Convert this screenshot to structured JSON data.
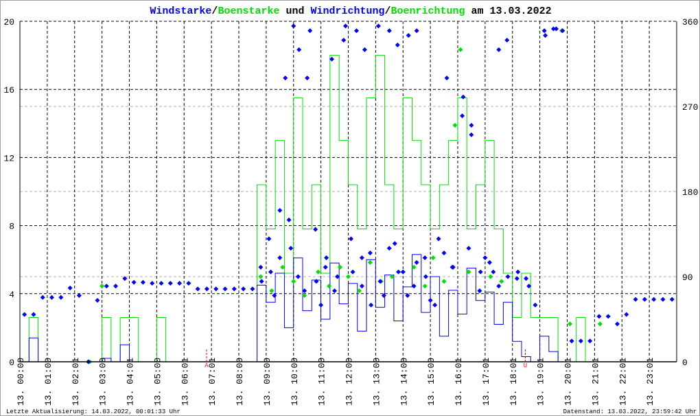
{
  "title": {
    "parts": [
      {
        "text": "Windstarke",
        "color": "#0000ff"
      },
      {
        "text": "/",
        "color": "#000000"
      },
      {
        "text": "Boenstarke",
        "color": "#00e000"
      },
      {
        "text": " und ",
        "color": "#000000"
      },
      {
        "text": "Windrichtung",
        "color": "#0000ff"
      },
      {
        "text": "/",
        "color": "#000000"
      },
      {
        "text": "Boenrichtung",
        "color": "#00e000"
      },
      {
        "text": " am 13.03.2022",
        "color": "#000000"
      }
    ]
  },
  "footer": {
    "left": "Letzte Aktualisierung: 14.03.2022, 00:01:33 Uhr",
    "right": "Datenstand: 13.03.2022, 23:59:42 Uhr"
  },
  "chart_data": {
    "type": "line",
    "title": "Windstarke/Boenstarke und Windrichtung/Boenrichtung am 13.03.2022",
    "xlabel": "",
    "ylabel": "",
    "xlim": [
      0,
      24
    ],
    "ylim": [
      0,
      20
    ],
    "y2lim": [
      0,
      360
    ],
    "yticks": [
      0,
      4,
      8,
      12,
      16,
      20
    ],
    "y2ticks": [
      0,
      90,
      180,
      270,
      360
    ],
    "xtick_labels": [
      "13. 00:00",
      "13. 01:00",
      "13. 02:01",
      "13. 03:00",
      "13. 04:01",
      "13. 05:00",
      "13. 06:01",
      "13. 07:01",
      "13. 08:00",
      "13. 09:00",
      "13. 10:00",
      "13. 11:00",
      "13. 12:00",
      "13. 13:00",
      "13. 14:00",
      "13. 15:00",
      "13. 16:01",
      "13. 17:01",
      "13. 18:01",
      "13. 19:01",
      "13. 20:01",
      "13. 21:01",
      "13. 22:01",
      "13. 23:01"
    ],
    "grid": true,
    "colors": {
      "wind": "#0000ff",
      "gust": "#00e000",
      "marker": "#ff0000",
      "grid": "#000000",
      "grid2": "#b0b0b0"
    },
    "sun_markers": [
      {
        "label": "A",
        "hour": 6.82
      },
      {
        "label": "U",
        "hour": 18.47
      }
    ],
    "step_hours": 0.3333,
    "series": [
      {
        "name": "Windstarke",
        "kind": "step",
        "axis": "left",
        "values": [
          0,
          1.4,
          0,
          0,
          0,
          0,
          0,
          0,
          0,
          0.2,
          0,
          1.0,
          0,
          0,
          0,
          0,
          0,
          0,
          0,
          0,
          0,
          0,
          0,
          0,
          0,
          0,
          4.5,
          3.5,
          5.2,
          2.0,
          6.1,
          3.0,
          4.8,
          2.5,
          5.8,
          3.4,
          4.6,
          1.8,
          6.0,
          3.2,
          5.1,
          2.4,
          4.4,
          6.3,
          2.9,
          5.0,
          1.5,
          4.2,
          2.8,
          5.5,
          3.6,
          4.1,
          2.2,
          3.5,
          1.2,
          0.3,
          0,
          1.5,
          0.6,
          0,
          0,
          0,
          0,
          0,
          0,
          0,
          0,
          0,
          0,
          0,
          0,
          0
        ]
      },
      {
        "name": "Boenstarke",
        "kind": "step",
        "axis": "left",
        "values": [
          0,
          2.6,
          0,
          0,
          0,
          0,
          0,
          0,
          0,
          2.6,
          0,
          2.6,
          2.6,
          0,
          0,
          2.6,
          0,
          0,
          0,
          0,
          0,
          0,
          0,
          0,
          0,
          0,
          10.4,
          7.8,
          13,
          5.2,
          15.5,
          7.8,
          10.4,
          5.2,
          18,
          13,
          10.4,
          7.8,
          15.5,
          18,
          10.4,
          7.8,
          15.5,
          13,
          10.4,
          7.8,
          10.4,
          13,
          15.5,
          7.8,
          10.4,
          13,
          7.8,
          5.2,
          2.6,
          5.2,
          2.6,
          2.6,
          2.6,
          0,
          0,
          2.6,
          0,
          0,
          0,
          0,
          0,
          0,
          0,
          0,
          0,
          0
        ]
      },
      {
        "name": "Windrichtung",
        "kind": "points",
        "axis": "right",
        "values": [
          50,
          50,
          68,
          68,
          68,
          78,
          70,
          0,
          65,
          80,
          80,
          88,
          84,
          84,
          83,
          83,
          83,
          83,
          83,
          77,
          77,
          77,
          77,
          77,
          77,
          77,
          85,
          95,
          110,
          150,
          90,
          300,
          85,
          100,
          75,
          340,
          95,
          110,
          60,
          85,
          120,
          95,
          70,
          105,
          90,
          60,
          115,
          100,
          260,
          240,
          95,
          105,
          80,
          90,
          88,
          88,
          60,
          350,
          352,
          350,
          22,
          22,
          22,
          48,
          48,
          40,
          50,
          66,
          66,
          66,
          66,
          66
        ],
        "extra_points": [
          [
            8.8,
            100
          ],
          [
            9.1,
            130
          ],
          [
            9.3,
            70
          ],
          [
            9.5,
            160
          ],
          [
            9.7,
            300
          ],
          [
            9.9,
            120
          ],
          [
            10.0,
            355
          ],
          [
            10.2,
            330
          ],
          [
            10.4,
            75
          ],
          [
            10.6,
            350
          ],
          [
            10.8,
            140
          ],
          [
            11.0,
            60
          ],
          [
            11.2,
            110
          ],
          [
            11.4,
            320
          ],
          [
            11.6,
            90
          ],
          [
            11.9,
            355
          ],
          [
            12.1,
            130
          ],
          [
            12.3,
            350
          ],
          [
            12.5,
            80
          ],
          [
            12.6,
            330
          ],
          [
            12.8,
            115
          ],
          [
            13.1,
            355
          ],
          [
            13.3,
            70
          ],
          [
            13.5,
            350
          ],
          [
            13.7,
            125
          ],
          [
            13.8,
            335
          ],
          [
            14.0,
            95
          ],
          [
            14.2,
            345
          ],
          [
            14.4,
            80
          ],
          [
            14.5,
            350
          ],
          [
            14.8,
            110
          ],
          [
            15.0,
            65
          ],
          [
            15.3,
            130
          ],
          [
            15.6,
            300
          ],
          [
            15.8,
            100
          ],
          [
            16.2,
            280
          ],
          [
            16.4,
            120
          ],
          [
            16.5,
            250
          ],
          [
            16.8,
            75
          ],
          [
            17.0,
            110
          ],
          [
            17.3,
            95
          ],
          [
            17.5,
            330
          ],
          [
            17.8,
            340
          ],
          [
            18.2,
            95
          ],
          [
            18.6,
            80
          ],
          [
            19.2,
            345
          ],
          [
            19.6,
            352
          ]
        ]
      },
      {
        "name": "Boenrichtung",
        "kind": "points",
        "axis": "right",
        "points": [
          [
            0.5,
            50
          ],
          [
            2.55,
            0
          ],
          [
            3.0,
            80
          ],
          [
            8.8,
            90
          ],
          [
            9.2,
            75
          ],
          [
            9.6,
            100
          ],
          [
            10.0,
            85
          ],
          [
            10.4,
            70
          ],
          [
            10.9,
            95
          ],
          [
            11.3,
            80
          ],
          [
            11.7,
            100
          ],
          [
            12.0,
            90
          ],
          [
            12.4,
            75
          ],
          [
            12.8,
            105
          ],
          [
            13.2,
            85
          ],
          [
            13.6,
            90
          ],
          [
            14.0,
            95
          ],
          [
            14.4,
            100
          ],
          [
            14.8,
            80
          ],
          [
            15.1,
            110
          ],
          [
            15.5,
            85
          ],
          [
            15.9,
            250
          ],
          [
            16.1,
            330
          ],
          [
            16.4,
            95
          ],
          [
            16.8,
            75
          ],
          [
            17.2,
            90
          ],
          [
            17.6,
            85
          ],
          [
            19.8,
            350
          ],
          [
            20.1,
            40
          ],
          [
            21.2,
            40
          ]
        ]
      }
    ]
  }
}
